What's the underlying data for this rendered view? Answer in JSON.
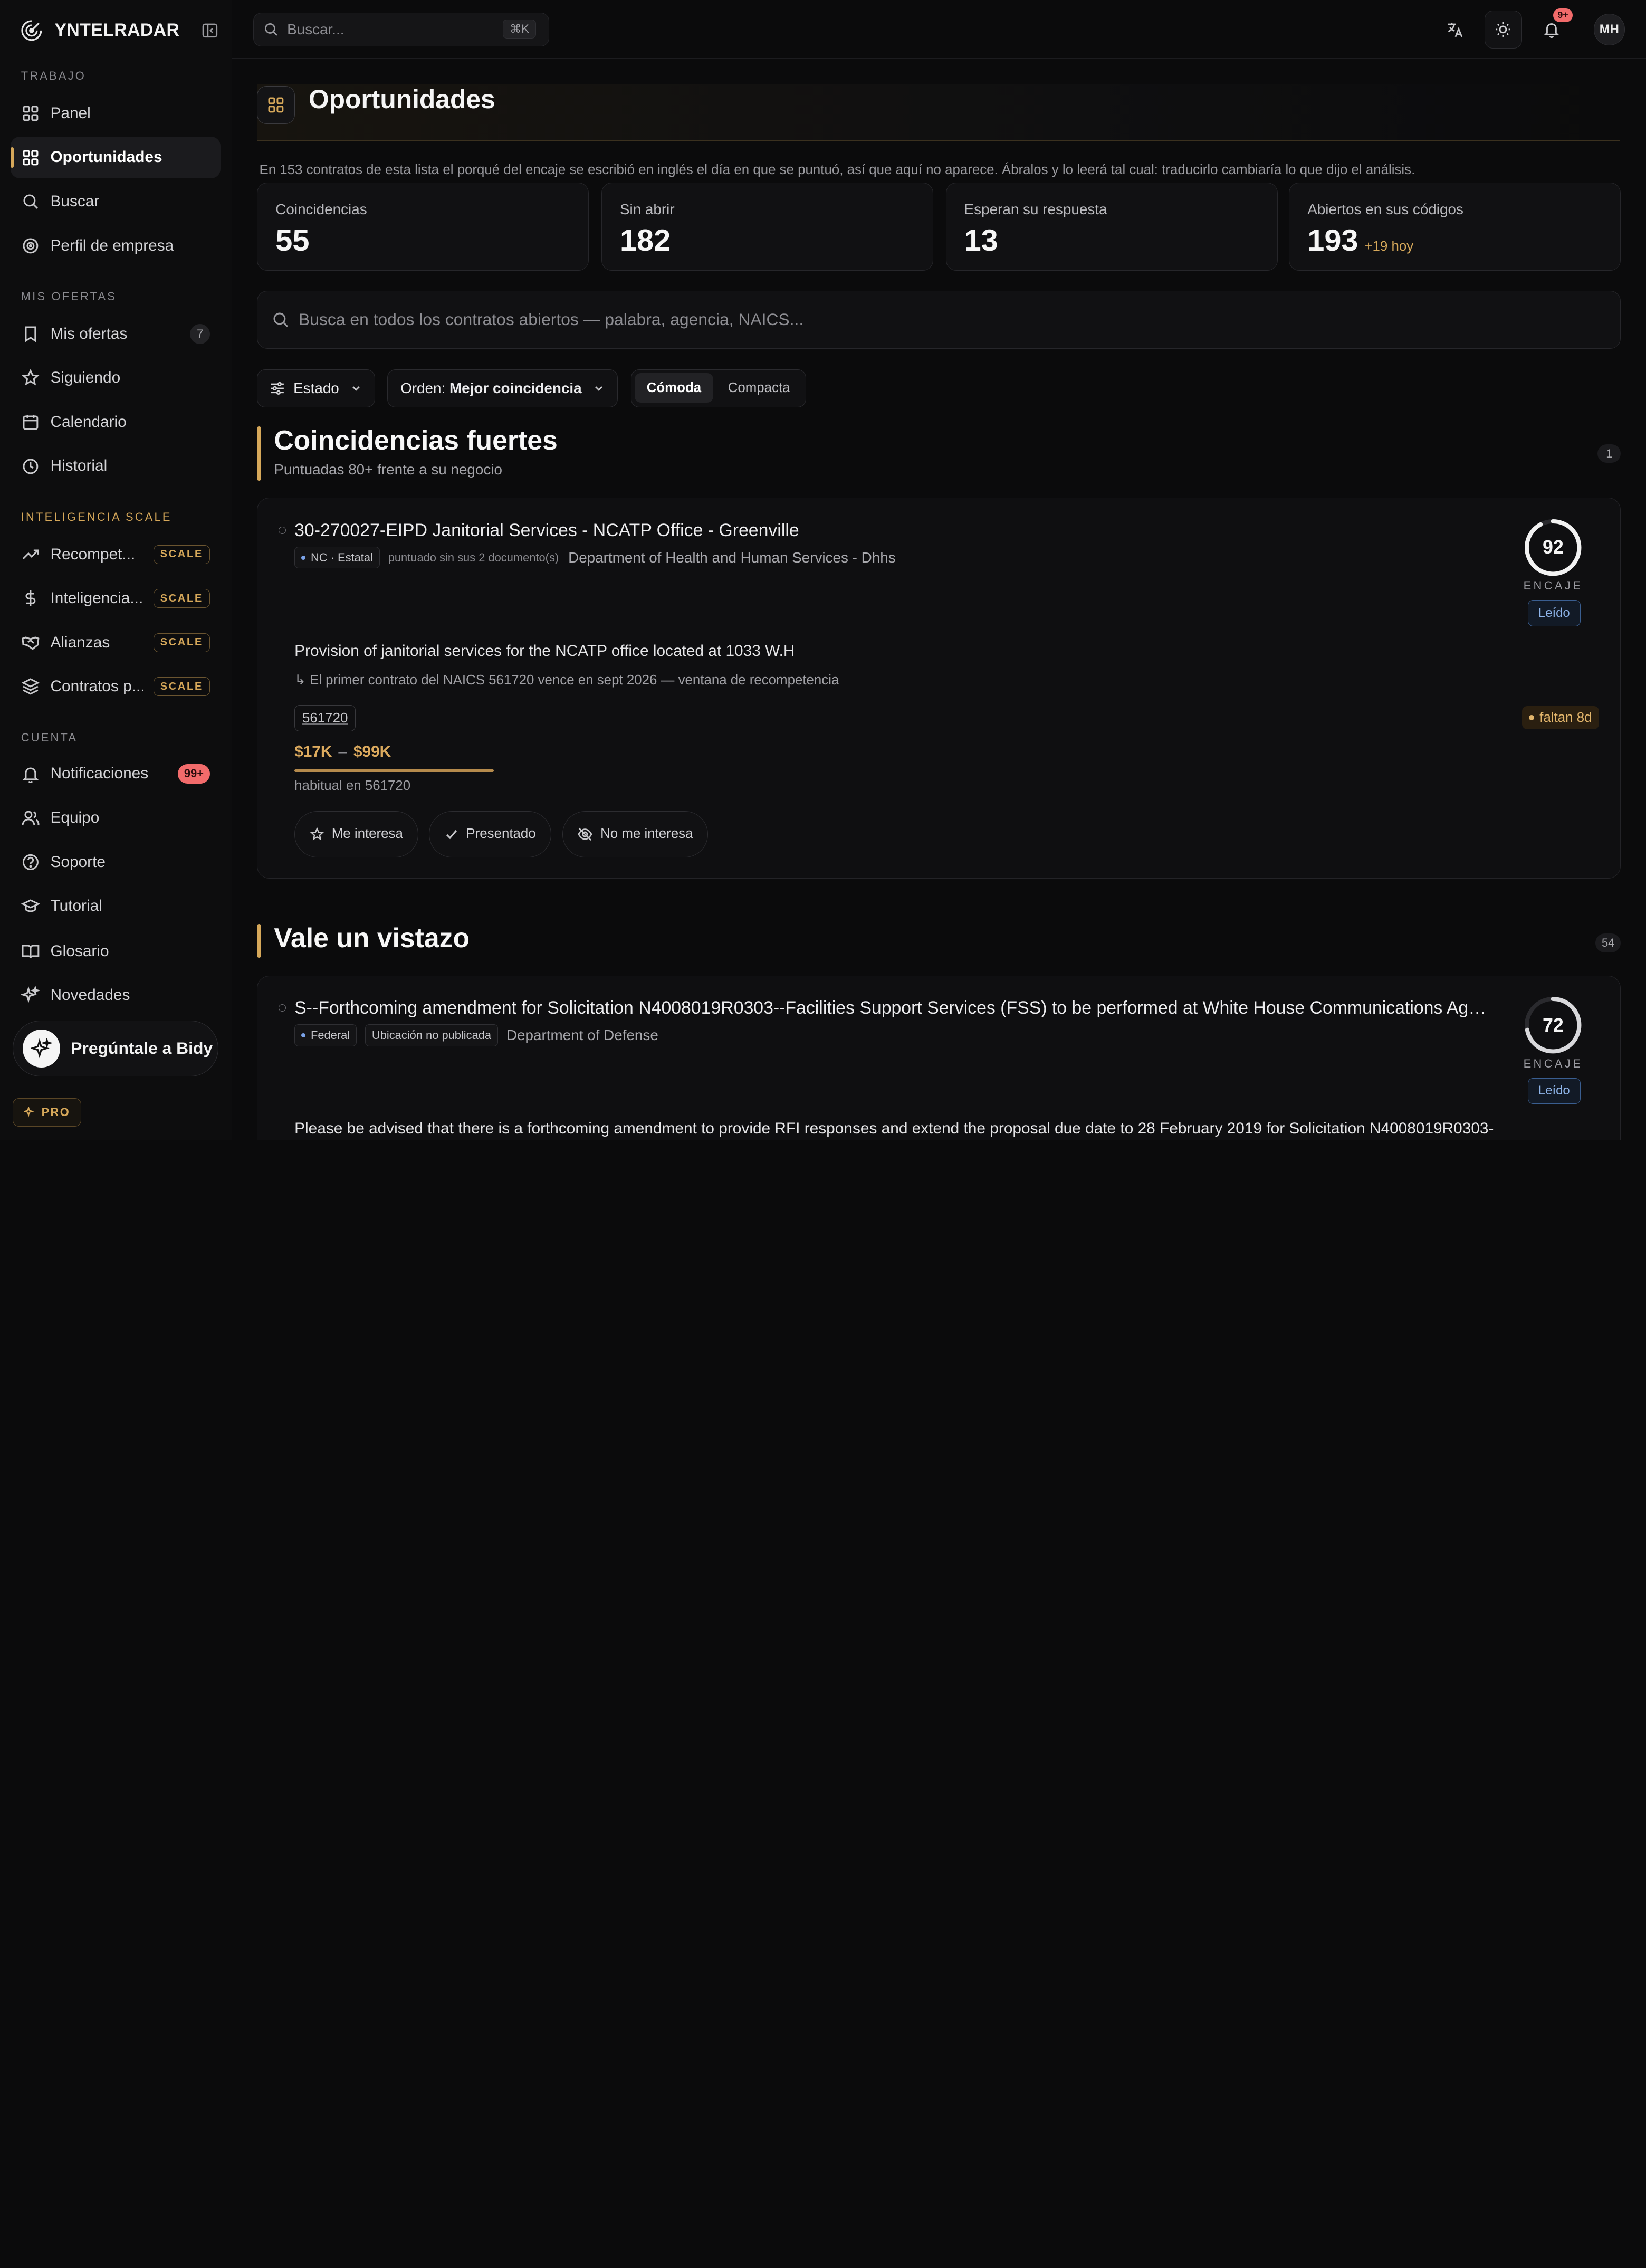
{
  "brand": {
    "name": "YNTELRADAR"
  },
  "sidebar": {
    "sections": {
      "trabajo": "TRABAJO",
      "mis_ofertas": "MIS OFERTAS",
      "inteligencia": "INTELIGENCIA SCALE",
      "cuenta": "CUENTA"
    },
    "trabajo": [
      {
        "label": "Panel",
        "icon": "grid-icon"
      },
      {
        "label": "Oportunidades",
        "icon": "grid-icon",
        "active": true
      },
      {
        "label": "Buscar",
        "icon": "search-icon"
      },
      {
        "label": "Perfil de empresa",
        "icon": "target-icon"
      }
    ],
    "mis_ofertas": [
      {
        "label": "Mis ofertas",
        "icon": "bookmark-icon",
        "count": "7"
      },
      {
        "label": "Siguiendo",
        "icon": "star-icon"
      },
      {
        "label": "Calendario",
        "icon": "calendar-icon"
      },
      {
        "label": "Historial",
        "icon": "clock-icon"
      }
    ],
    "inteligencia": [
      {
        "label": "Recompet...",
        "icon": "trend-icon",
        "tag": "SCALE"
      },
      {
        "label": "Inteligencia...",
        "icon": "dollar-icon",
        "tag": "SCALE"
      },
      {
        "label": "Alianzas",
        "icon": "handshake-icon",
        "tag": "SCALE"
      },
      {
        "label": "Contratos p...",
        "icon": "layers-icon",
        "tag": "SCALE"
      }
    ],
    "cuenta": [
      {
        "label": "Notificaciones",
        "icon": "bell-icon",
        "badge": "99+"
      },
      {
        "label": "Equipo",
        "icon": "users-icon"
      },
      {
        "label": "Soporte",
        "icon": "help-icon"
      },
      {
        "label": "Tutorial",
        "icon": "graduation-icon"
      },
      {
        "label": "Glosario",
        "icon": "book-icon"
      },
      {
        "label": "Novedades",
        "icon": "sparkles-icon"
      }
    ],
    "ask": "Pregúntale a Bidy",
    "plan": "PRO"
  },
  "topbar": {
    "search_placeholder": "Buscar...",
    "shortcut": "⌘K",
    "notif_badge": "9+",
    "avatar_initials": "MH"
  },
  "page": {
    "title": "Oportunidades",
    "notice": "En 153 contratos de esta lista el porqué del encaje se escribió en inglés el día en que se puntuó, así que aquí no aparece. Ábralos y lo leerá tal cual: traducirlo cambiaría lo que dijo el análisis."
  },
  "stats": [
    {
      "label": "Coincidencias",
      "value": "55"
    },
    {
      "label": "Sin abrir",
      "value": "182"
    },
    {
      "label": "Esperan su respuesta",
      "value": "13"
    },
    {
      "label": "Abiertos en sus códigos",
      "value": "193",
      "delta": "+19 hoy"
    }
  ],
  "search": {
    "placeholder": "Busca en todos los contratos abiertos — palabra, agencia, NAICS..."
  },
  "filters": {
    "estado": "Estado",
    "orden_prefix": "Orden:",
    "orden_value": "Mejor coincidencia",
    "view_comfortable": "Cómoda",
    "view_compact": "Compacta"
  },
  "sections": {
    "strong": {
      "title": "Coincidencias fuertes",
      "subtitle": "Puntuadas 80+ frente a su negocio",
      "count": "1"
    },
    "glance": {
      "title": "Vale un vistazo",
      "count": "54"
    }
  },
  "cards": [
    {
      "title": "30-270027-EIPD Janitorial Services - NCATP Office - Greenville",
      "chip": "NC · Estatal",
      "note": "puntuado sin sus 2 documento(s)",
      "agency": "Department of Health and Human Services - Dhhs",
      "score": 92,
      "score_label": "ENCAJE",
      "status": "Leído",
      "description": "Provision of janitorial services for the NCATP office located at 1033 W.H",
      "hint": "↳ El primer contrato del NAICS 561720 vence en sept 2026 — ventana de recompetencia",
      "naics": "561720",
      "deadline": "faltan 8d",
      "price_low": "$17K",
      "price_high": "$99K",
      "price_sep": "–",
      "price_fill": 1.0,
      "usual": "habitual en 561720",
      "actions": {
        "interest": "Me interesa",
        "submitted": "Presentado",
        "not_interested": "No me interesa"
      }
    },
    {
      "title": "S--Forthcoming amendment for Solicitation N4008019R0303--Facilities Support Services (FSS) to be performed at White House Communications Age...",
      "chip": "Federal",
      "chip2": "Ubicación no publicada",
      "agency": "Department of Defense",
      "score": 72,
      "score_label": "ENCAJE",
      "status": "Leído",
      "description": "Please be advised that there is a forthcoming amendment to provide RFI responses and extend the proposal due date to 28 February 2019 for Solicitation N4008019R0303-"
    }
  ],
  "colors": {
    "accent": "#d6a85a",
    "danger": "#f26b6b",
    "info": "#8fb5ea"
  }
}
